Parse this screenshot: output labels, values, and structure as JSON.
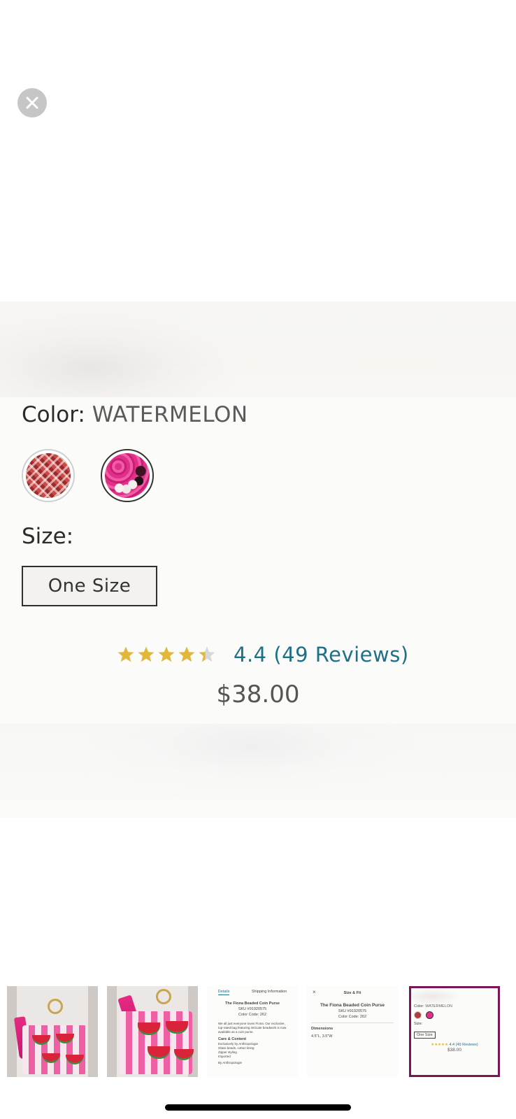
{
  "close_button": {
    "icon": "close-icon",
    "label": "Close"
  },
  "product": {
    "color_label": "Color:",
    "color_value": "WATERMELON",
    "swatches": [
      {
        "name": "red",
        "selected": false
      },
      {
        "name": "watermelon",
        "selected": true
      }
    ],
    "size_label": "Size:",
    "size_option": "One Size",
    "rating": 4.4,
    "rating_stars_filled": 4.4,
    "rating_max": 5,
    "reviews_text": "4.4 (49 Reviews)",
    "price": "$38.00"
  },
  "colors": {
    "star_filled": "#e2b73a",
    "star_empty": "#d8d8d8",
    "link": "#1f6f86",
    "selected_thumb_border": "#7a1558"
  },
  "thumbnails": {
    "selected_index": 4,
    "details": {
      "tab1": "Details",
      "tab2": "Shipping Information",
      "title": "The Fiona Beaded Coin Purse",
      "sku": "SKU #91920575",
      "color_code": "Color Code: 262",
      "body": "We all just everyone loves Fiona. Our exclusive, top-rated bag featuring intricate beadwork is now available as a coin purse.",
      "care_heading": "Care & Content",
      "care_lines": [
        "Exclusively by Anthropologie",
        "Glass beads, cotton lining",
        "Zipper styling",
        "Imported"
      ],
      "brand": "By Anthropologie"
    },
    "size_fit": {
      "header": "Size & Fit",
      "title": "The Fiona Beaded Coin Purse",
      "sku": "SKU #91920575",
      "color_code": "Color Code: 262",
      "dimensions_heading": "Dimensions",
      "dimensions": "4.5\"L, 3.5\"W"
    },
    "mini_product": {
      "color_label": "Color:",
      "color_value": "WATERMELON",
      "size_label": "Size:",
      "size_option": "One Size",
      "reviews_text": "4.4 (49 Reviews)",
      "price": "$38.00"
    }
  },
  "home_indicator": "home-indicator"
}
